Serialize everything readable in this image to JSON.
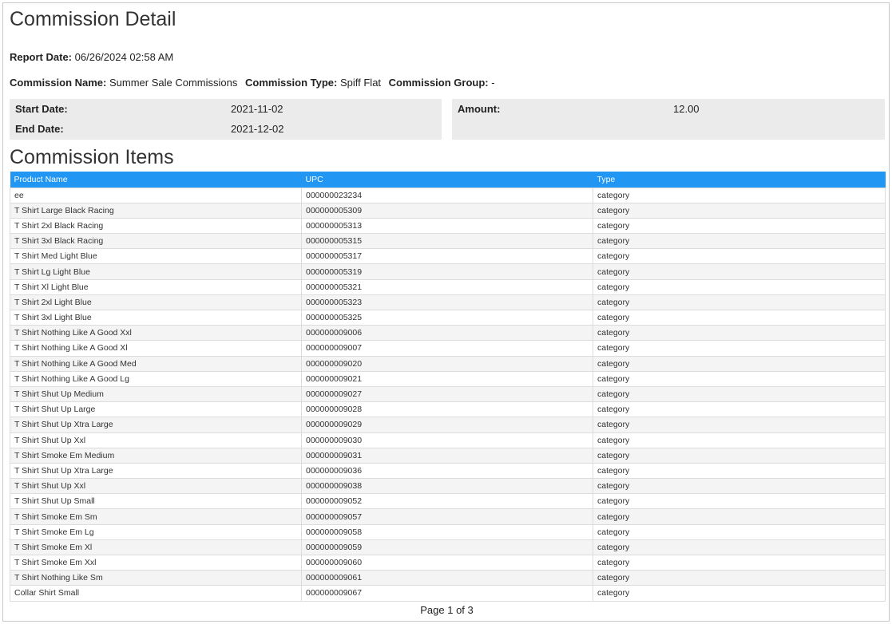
{
  "report": {
    "title": "Commission Detail",
    "report_date_label": "Report Date:",
    "report_date": "06/26/2024 02:58 AM",
    "commission_name_label": "Commission Name:",
    "commission_name": "Summer Sale Commissions",
    "commission_type_label": "Commission Type:",
    "commission_type": "Spiff Flat",
    "commission_group_label": "Commission Group:",
    "commission_group": "-"
  },
  "details": {
    "start_date_label": "Start Date:",
    "start_date": "2021-11-02",
    "end_date_label": "End Date:",
    "end_date": "2021-12-02",
    "amount_label": "Amount:",
    "amount": "12.00"
  },
  "items": {
    "title": "Commission Items",
    "columns": [
      "Product Name",
      "UPC",
      "Type"
    ],
    "rows": [
      [
        "ee",
        "000000023234",
        "category"
      ],
      [
        "T Shirt Large Black Racing",
        "000000005309",
        "category"
      ],
      [
        "T Shirt 2xl Black Racing",
        "000000005313",
        "category"
      ],
      [
        "T Shirt 3xl Black Racing",
        "000000005315",
        "category"
      ],
      [
        "T Shirt Med Light Blue",
        "000000005317",
        "category"
      ],
      [
        "T Shirt Lg Light Blue",
        "000000005319",
        "category"
      ],
      [
        "T Shirt Xl Light Blue",
        "000000005321",
        "category"
      ],
      [
        "T Shirt 2xl Light Blue",
        "000000005323",
        "category"
      ],
      [
        "T Shirt 3xl Light Blue",
        "000000005325",
        "category"
      ],
      [
        "T Shirt Nothing Like A Good Xxl",
        "000000009006",
        "category"
      ],
      [
        "T Shirt Nothing Like A Good Xl",
        "000000009007",
        "category"
      ],
      [
        "T Shirt Nothing Like A Good Med",
        "000000009020",
        "category"
      ],
      [
        "T Shirt Nothing Like A Good Lg",
        "000000009021",
        "category"
      ],
      [
        "T Shirt Shut Up Medium",
        "000000009027",
        "category"
      ],
      [
        "T Shirt Shut Up Large",
        "000000009028",
        "category"
      ],
      [
        "T Shirt Shut Up Xtra Large",
        "000000009029",
        "category"
      ],
      [
        "T Shirt Shut Up Xxl",
        "000000009030",
        "category"
      ],
      [
        "T Shirt Smoke Em Medium",
        "000000009031",
        "category"
      ],
      [
        "T Shirt Shut Up Xtra Large",
        "000000009036",
        "category"
      ],
      [
        "T Shirt Shut Up Xxl",
        "000000009038",
        "category"
      ],
      [
        "T Shirt Shut Up Small",
        "000000009052",
        "category"
      ],
      [
        "T Shirt Smoke Em Sm",
        "000000009057",
        "category"
      ],
      [
        "T Shirt Smoke Em Lg",
        "000000009058",
        "category"
      ],
      [
        "T Shirt Smoke Em Xl",
        "000000009059",
        "category"
      ],
      [
        "T Shirt Smoke Em Xxl",
        "000000009060",
        "category"
      ],
      [
        "T Shirt Nothing Like Sm",
        "000000009061",
        "category"
      ],
      [
        "Collar Shirt Small",
        "000000009067",
        "category"
      ]
    ]
  },
  "footer": {
    "page_label": "Page 1 of 3"
  },
  "colors": {
    "header_bg": "#2196f3",
    "panel_bg": "#ebebeb"
  }
}
